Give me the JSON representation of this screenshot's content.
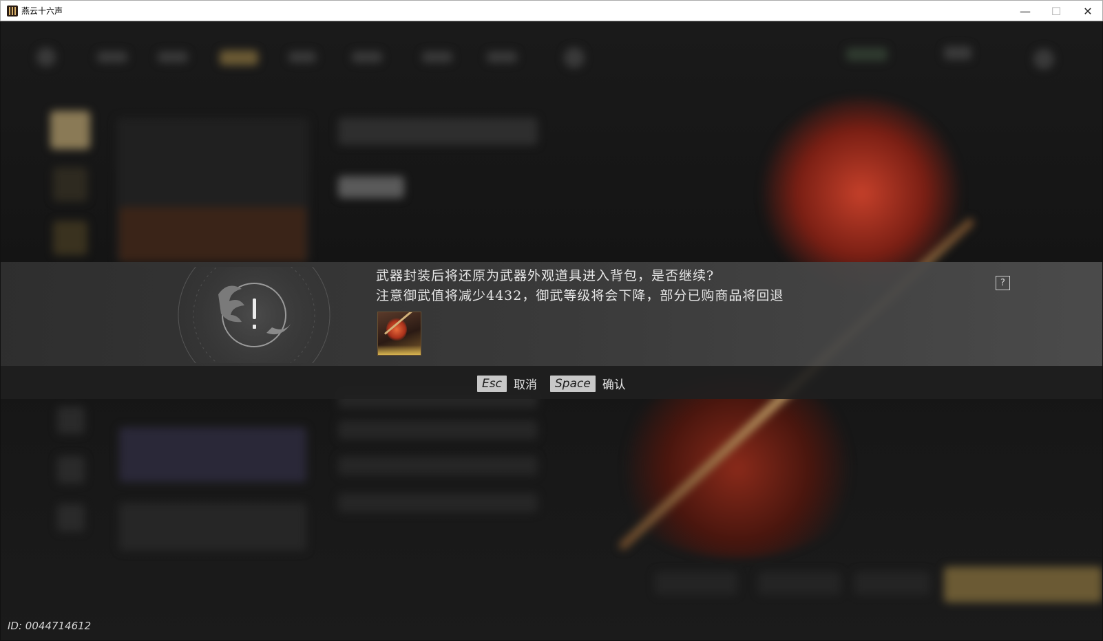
{
  "window": {
    "title": "燕云十六声",
    "minimize_glyph": "—",
    "maximize_glyph": "☐",
    "close_glyph": "✕"
  },
  "dialog": {
    "icon": "warning-emblem-icon",
    "message_line1": "武器封装后将还原为武器外观道具进入背包，是否继续?",
    "message_line2": "注意御武值将减少4432，御武等级将会下降，部分已购商品将回退",
    "help_glyph": "?",
    "item_icon": "weapon-spear-icon",
    "cancel": {
      "key": "Esc",
      "label": "取消"
    },
    "confirm": {
      "key": "Space",
      "label": "确认"
    }
  },
  "footer": {
    "user_id": "ID: 0044714612"
  },
  "colors": {
    "dialog_band": "#3c3c3c",
    "dialog_footer": "#202020",
    "text": "#e6e6e6",
    "key_bg": "#c8c8c8"
  }
}
